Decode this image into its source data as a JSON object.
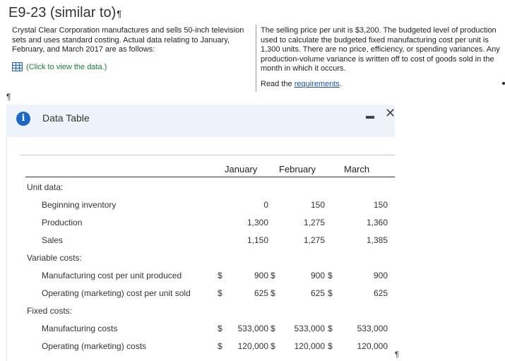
{
  "header": {
    "title": "E9-23 (similar to)",
    "pilcrow": "¶"
  },
  "problem": {
    "left_text": "Crystal Clear Corporation manufactures and sells 50-inch television sets and uses standard costing. Actual data relating to January, February, and March 2017 are as follows:",
    "click_link": "(Click to view the data.)",
    "right_text": "The selling price per unit is $3,200. The budgeted level of production used to calculate the budgeted fixed manufacturing cost per unit is 1,300 units. There are no price, efficiency, or spending variances. Any production-volume variance is written off to cost of goods sold in the month in which it occurs.",
    "read_prefix": "Read the ",
    "read_link": "requirements",
    "read_suffix": "."
  },
  "dialog": {
    "title": "Data Table",
    "info_glyph": "i",
    "minimize_glyph": "",
    "close_glyph": "✕"
  },
  "table": {
    "columns": [
      "January",
      "February",
      "March"
    ],
    "sections": [
      {
        "label": "Unit data:"
      },
      {
        "label": "Variable costs:"
      },
      {
        "label": "Fixed costs:"
      }
    ],
    "rows": {
      "beginning_inventory": {
        "label": "Beginning inventory",
        "values": [
          "0",
          "150",
          "150"
        ]
      },
      "production": {
        "label": "Production",
        "values": [
          "1,300",
          "1,275",
          "1,360"
        ]
      },
      "sales": {
        "label": "Sales",
        "values": [
          "1,150",
          "1,275",
          "1,385"
        ]
      },
      "mfg_cost_unit": {
        "label": "Manufacturing cost per unit produced",
        "values": [
          "900",
          "900",
          "900"
        ]
      },
      "op_cost_unit": {
        "label": "Operating (marketing) cost per unit sold",
        "values": [
          "625",
          "625",
          "625"
        ]
      },
      "mfg_costs": {
        "label": "Manufacturing costs",
        "values": [
          "533,000",
          "533,000",
          "533,000"
        ]
      },
      "op_costs": {
        "label": "Operating (marketing) costs",
        "values": [
          "120,000",
          "120,000",
          "120,000"
        ]
      }
    },
    "dollar": "$"
  },
  "colors": {
    "info_blue": "#1b68c9",
    "link_green": "#1a7a3c",
    "link_blue": "#1a4fc4",
    "dialog_header_bg": "#eef3fb"
  }
}
